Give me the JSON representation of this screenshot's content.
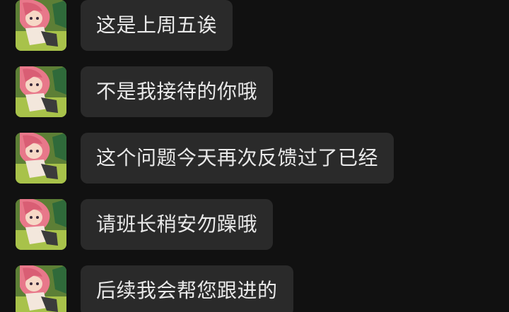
{
  "theme": {
    "background": "#111111",
    "bubble_color": "#2a2a2a",
    "text_color": "#e9e9e9"
  },
  "messages": [
    {
      "sender_avatar": "anime-girl-avatar",
      "text": "这是上周五诶"
    },
    {
      "sender_avatar": "anime-girl-avatar",
      "text": "不是我接待的你哦"
    },
    {
      "sender_avatar": "anime-girl-avatar",
      "text": "这个问题今天再次反馈过了已经"
    },
    {
      "sender_avatar": "anime-girl-avatar",
      "text": "请班长稍安勿躁哦"
    },
    {
      "sender_avatar": "anime-girl-avatar",
      "text": "后续我会帮您跟进的"
    }
  ]
}
